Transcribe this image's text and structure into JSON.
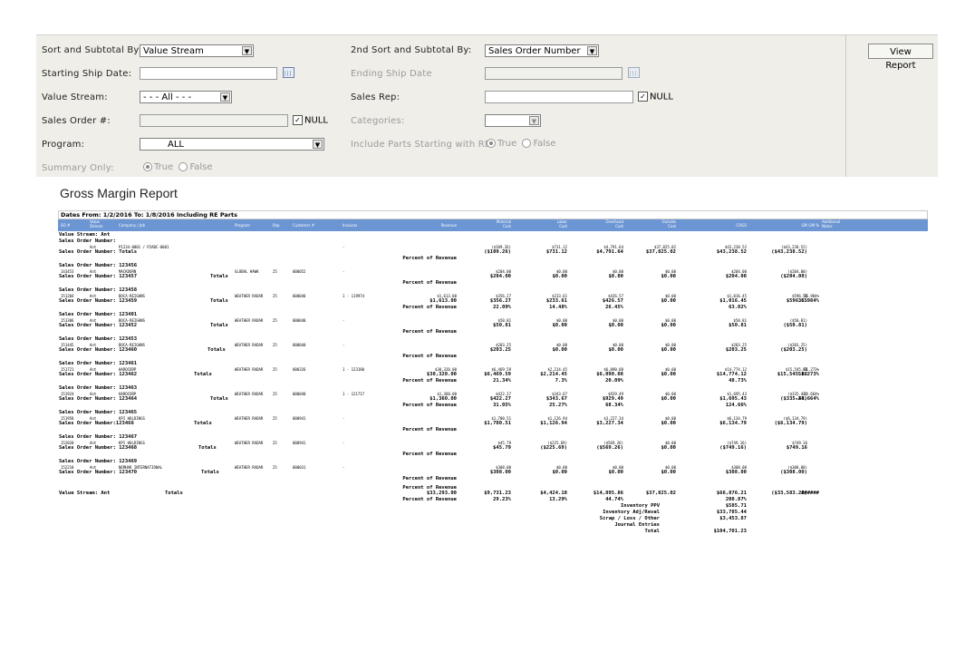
{
  "filters": {
    "sort_label": "Sort and Subtotal By:",
    "sort_value": "Value Stream",
    "sort2_label": "2nd Sort and Subtotal By:",
    "sort2_value": "Sales Order Number",
    "start_label": "Starting Ship Date:",
    "start_value": "",
    "end_label": "Ending Ship Date",
    "end_value": "",
    "vs_label": "Value Stream:",
    "vs_value": "- - - All - - -",
    "rep_label": "Sales Rep:",
    "rep_value": "",
    "null_label": "NULL",
    "so_label": "Sales Order #:",
    "so_value": "",
    "cat_label": "Categories:",
    "cat_value": "",
    "prog_label": "Program:",
    "prog_value": "ALL",
    "re_label": "Include Parts Starting with RE:",
    "true_label": "True",
    "false_label": "False",
    "summary_label": "Summary Only:",
    "view_report": "View Report"
  },
  "report": {
    "title": "Gross Margin Report",
    "dates_line": "Dates From: 1/2/2016 To: 1/8/2016 Including RE Parts",
    "columns": {
      "so": "SO #",
      "stream": "Value\nStream",
      "company": "Company / Job",
      "program": "Program",
      "rep": "Rep",
      "customer": "Customer #",
      "invoices": "Invoices",
      "revenue": "Revenue",
      "material": "Material\nCost",
      "labor": "Labor\nCost",
      "overhead": "Overhead\nCost",
      "outside": "Outside\nCost",
      "cogs": "COGS",
      "gm": "GM",
      "gmpct": "GM %",
      "notes": "Additional\nNotes"
    },
    "value_stream_heading": "Value Stream: Ant",
    "pct_label": "Percent of Revenue",
    "groups": [
      {
        "header": "Sales Order Number:",
        "detail": {
          "so": "",
          "stream": "Ant",
          "company": "P1234-0001 / P2ABC-0001",
          "program": "",
          "rep": "",
          "cust": "",
          "inv": "-",
          "rev": "",
          "mat": "($109.26)",
          "lab": "$731.12",
          "ovh": "$4,791.64",
          "out": "$37,825.02",
          "cogs": "$43,238.52",
          "gm": "($43,238.52)",
          "gmpct": ""
        },
        "totals_label": "Sales Order Number:  Totals",
        "totals_word": "",
        "totals": {
          "rev": "",
          "mat": "($109.26)",
          "lab": "$731.12",
          "ovh": "$4,791.64",
          "out": "$37,825.02",
          "cogs": "$43,238.52",
          "gm": "($43,238.52)",
          "gmpct": ""
        },
        "pct": {
          "rev": "",
          "mat": "",
          "lab": "",
          "ovh": "",
          "cogs": ""
        }
      },
      {
        "header": "Sales Order Number: 123456",
        "detail": {
          "so": "143453",
          "stream": "Ant",
          "company": "MACKDORN",
          "program": "GLOBAL HAWK",
          "rep": "25",
          "cust": "000052",
          "inv": "-",
          "rev": "",
          "mat": "$204.00",
          "lab": "$0.00",
          "ovh": "$0.00",
          "out": "$0.00",
          "cogs": "$204.00",
          "gm": "($204.00)",
          "gmpct": ""
        },
        "totals_label": "Sales Order Number: 123457",
        "totals_word": "Totals",
        "totals": {
          "rev": "",
          "mat": "$204.00",
          "lab": "$0.00",
          "ovh": "$0.00",
          "out": "$0.00",
          "cogs": "$204.00",
          "gm": "($204.00)",
          "gmpct": ""
        },
        "pct": {
          "rev": "",
          "mat": "",
          "lab": "",
          "ovh": "",
          "cogs": ""
        }
      },
      {
        "header": "Sales Order Number: 123458",
        "detail": {
          "so": "151284",
          "stream": "Ant",
          "company": "BOCA-REIGHNS",
          "program": "WEATHER RADAR",
          "rep": "25",
          "cust": "000040",
          "inv": "1 - 119974",
          "rev": "$1,613.00",
          "mat": "$356.27",
          "lab": "$233.61",
          "ovh": "$426.57",
          "out": "$0.00",
          "cogs": "$1,016.45",
          "gm": "$596.55",
          "gmpct": "36.984%"
        },
        "totals_label": "Sales Order Number: 123459",
        "totals_word": "Totals",
        "totals": {
          "rev": "$1,613.00",
          "mat": "$356.27",
          "lab": "$233.61",
          "ovh": "$426.57",
          "out": "$0.00",
          "cogs": "$1,016.45",
          "gm": "$596.55",
          "gmpct": "36.984%"
        },
        "pct": {
          "rev": "",
          "mat": "22.09%",
          "lab": "14.48%",
          "ovh": "26.45%",
          "cogs": "63.02%"
        }
      },
      {
        "header": "Sales Order Number: 123401",
        "detail": {
          "so": "151306",
          "stream": "Ant",
          "company": "BOCA-REIGHNS",
          "program": "WEATHER RADAR",
          "rep": "25",
          "cust": "000040",
          "inv": "-",
          "rev": "",
          "mat": "$50.81",
          "lab": "$0.00",
          "ovh": "$0.00",
          "out": "$0.00",
          "cogs": "$50.81",
          "gm": "($50.81)",
          "gmpct": ""
        },
        "totals_label": "Sales Order Number: 123452",
        "totals_word": "Totals",
        "totals": {
          "rev": "",
          "mat": "$50.81",
          "lab": "$0.00",
          "ovh": "$0.00",
          "out": "$0.00",
          "cogs": "$50.81",
          "gm": "($50.81)",
          "gmpct": ""
        },
        "pct": {
          "rev": "",
          "mat": "",
          "lab": "",
          "ovh": "",
          "cogs": ""
        }
      },
      {
        "header": "Sales Order Number: 123453",
        "detail": {
          "so": "151445",
          "stream": "Ant",
          "company": "BOCA-REIGHNS",
          "program": "WEATHER RADAR",
          "rep": "25",
          "cust": "000040",
          "inv": "-",
          "rev": "",
          "mat": "$203.25",
          "lab": "$0.00",
          "ovh": "$0.00",
          "out": "$0.00",
          "cogs": "$203.25",
          "gm": "($203.25)",
          "gmpct": ""
        },
        "totals_label": "Sales Order Number: 123460",
        "totals_word": "Totals",
        "totals": {
          "rev": "",
          "mat": "$203.25",
          "lab": "$0.00",
          "ovh": "$0.00",
          "out": "$0.00",
          "cogs": "$203.25",
          "gm": "($203.25)",
          "gmpct": ""
        },
        "pct": {
          "rev": "",
          "mat": "",
          "lab": "",
          "ovh": "",
          "cogs": ""
        }
      },
      {
        "header": "Sales Order Number: 123461",
        "detail": {
          "so": "151721",
          "stream": "Ant",
          "company": "HAROCORP",
          "program": "WEATHER RADAR",
          "rep": "25",
          "cust": "000326",
          "inv": "1 - 123180",
          "rev": "$30,320.00",
          "mat": "$6,469.59",
          "lab": "$2,214.45",
          "ovh": "$6,090.08",
          "out": "$0.00",
          "cogs": "$14,774.12",
          "gm": "$15,545.88",
          "gmpct": "51.273%"
        },
        "totals_label": "Sales Order Number: 123462",
        "totals_word": "Totals",
        "totals": {
          "rev": "$30,320.00",
          "mat": "$6,469.59",
          "lab": "$2,214.45",
          "ovh": "$6,090.08",
          "out": "$0.00",
          "cogs": "$14,774.12",
          "gm": "$15,545.88",
          "gmpct": "51.273%"
        },
        "pct": {
          "rev": "",
          "mat": "21.34%",
          "lab": "7.3%",
          "ovh": "20.09%",
          "cogs": "48.73%"
        }
      },
      {
        "header": "Sales Order Number: 123463",
        "detail": {
          "so": "151924",
          "stream": "Ant",
          "company": "HAROCORP",
          "program": "WEATHER RADAR",
          "rep": "25",
          "cust": "000040",
          "inv": "1 - 121717",
          "rev": "$1,360.00",
          "mat": "$422.27",
          "lab": "$343.67",
          "ovh": "$929.49",
          "out": "$0.00",
          "cogs": "$1,695.43",
          "gm": "($335.43)",
          "gmpct": "-24.664%"
        },
        "totals_label": "Sales Order Number: 123464",
        "totals_word": "Totals",
        "totals": {
          "rev": "$1,360.00",
          "mat": "$422.27",
          "lab": "$343.67",
          "ovh": "$929.49",
          "out": "$0.00",
          "cogs": "$1,695.43",
          "gm": "($335.43)",
          "gmpct": "-24.664%"
        },
        "pct": {
          "rev": "",
          "mat": "31.05%",
          "lab": "25.27%",
          "ovh": "68.34%",
          "cogs": "124.66%"
        }
      },
      {
        "header": "Sales Order Number: 123465",
        "detail": {
          "so": "151958",
          "stream": "Ant",
          "company": "KPI HOLDINGS",
          "program": "WEATHER RADAR",
          "rep": "25",
          "cust": "000941",
          "inv": "-",
          "rev": "",
          "mat": "$1,780.51",
          "lab": "$1,126.94",
          "ovh": "$3,227.34",
          "out": "$0.00",
          "cogs": "$6,134.79",
          "gm": "($6,134.79)",
          "gmpct": ""
        },
        "totals_label": "Sales Order Number:123466",
        "totals_word": "Totals",
        "totals": {
          "rev": "",
          "mat": "$1,780.51",
          "lab": "$1,126.94",
          "ovh": "$3,227.34",
          "out": "$0.00",
          "cogs": "$6,134.79",
          "gm": "($6,134.79)",
          "gmpct": ""
        },
        "pct": {
          "rev": "",
          "mat": "",
          "lab": "",
          "ovh": "",
          "cogs": ""
        }
      },
      {
        "header": "Sales Order Number: 123467",
        "detail": {
          "so": "152020",
          "stream": "Ant",
          "company": "KPI HOLDINGS",
          "program": "WEATHER RADAR",
          "rep": "25",
          "cust": "000941",
          "inv": "-",
          "rev": "",
          "mat": "$45.79",
          "lab": "($225.69)",
          "ovh": "($569.26)",
          "out": "$0.00",
          "cogs": "($749.16)",
          "gm": "$749.16",
          "gmpct": ""
        },
        "totals_label": "Sales Order Number: 123468",
        "totals_word": "Totals",
        "totals": {
          "rev": "",
          "mat": "$45.79",
          "lab": "($225.69)",
          "ovh": "($569.26)",
          "out": "$0.00",
          "cogs": "($749.16)",
          "gm": "$749.16",
          "gmpct": ""
        },
        "pct": {
          "rev": "",
          "mat": "",
          "lab": "",
          "ovh": "",
          "cogs": ""
        }
      },
      {
        "header": "Sales Order Number: 123469",
        "detail": {
          "so": "152210",
          "stream": "Ant",
          "company": "NEMHAR INTERNATIONAL",
          "program": "WEATHER RADAR",
          "rep": "25",
          "cust": "000031",
          "inv": "-",
          "rev": "",
          "mat": "$308.00",
          "lab": "$0.00",
          "ovh": "$0.00",
          "out": "$0.00",
          "cogs": "$308.00",
          "gm": "($308.00)",
          "gmpct": ""
        },
        "totals_label": "Sales Order Number: 123470",
        "totals_word": "Totals",
        "totals": {
          "rev": "",
          "mat": "$308.00",
          "lab": "$0.00",
          "ovh": "$0.00",
          "out": "$0.00",
          "cogs": "$308.00",
          "gm": "($308.00)",
          "gmpct": ""
        },
        "pct": {
          "rev": "",
          "mat": "",
          "lab": "",
          "ovh": "",
          "cogs": ""
        }
      }
    ],
    "vs_totals": {
      "label": "Value Stream: Ant",
      "word": "Totals",
      "pct_label_top": "Percent of Revenue",
      "rev": "$33,293.00",
      "mat": "$9,731.23",
      "lab": "$4,424.10",
      "ovh": "$14,895.86",
      "out": "$37,825.02",
      "cogs": "$66,876.21",
      "gm": "($33,583.21)",
      "gmpct": "######",
      "pct_label": "Percent of Revenue",
      "pct_mat": "29.23%",
      "pct_lab": "13.29%",
      "pct_ovh": "44.74%",
      "pct_cogs": "200.87%"
    },
    "extras": [
      {
        "label": "Inventory PPV",
        "value": "$585.71"
      },
      {
        "label": "Inventory Adj/Reval",
        "value": "$33,785.44"
      },
      {
        "label": "Scrap / Loss / Other",
        "value": "$3,453.87"
      },
      {
        "label": "Journal Entries",
        "value": ""
      },
      {
        "label": "Total",
        "value": "$104,701.23"
      }
    ]
  }
}
